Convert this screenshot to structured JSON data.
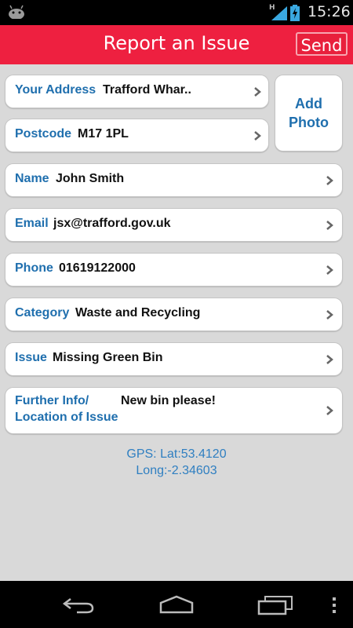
{
  "status_bar": {
    "network": "H",
    "time": "15:26"
  },
  "header": {
    "title": "Report an Issue",
    "send_label": "Send"
  },
  "photo": {
    "line1": "Add",
    "line2": "Photo"
  },
  "fields": {
    "address": {
      "label": "Your Address",
      "value": "Trafford Whar.."
    },
    "postcode": {
      "label": "Postcode",
      "value": "M17 1PL"
    },
    "name": {
      "label": "Name",
      "value": "John Smith"
    },
    "email": {
      "label": "Email",
      "value": "jsx@trafford.gov.uk"
    },
    "phone": {
      "label": "Phone",
      "value": "01619122000"
    },
    "category": {
      "label": "Category",
      "value": "Waste and Recycling"
    },
    "issue": {
      "label": "Issue",
      "value": "Missing Green Bin"
    },
    "further": {
      "label_line1": "Further Info/",
      "label_line2": "Location of Issue",
      "value": "New bin please!"
    }
  },
  "gps": {
    "lat": "GPS: Lat:53.4120",
    "long": "Long:-2.34603"
  },
  "icons": {
    "android": "android-icon",
    "signal": "signal-icon",
    "battery": "battery-charging-icon",
    "chevron": "chevron-right-icon",
    "back": "back-icon",
    "home": "home-icon",
    "recents": "recent-apps-icon",
    "menu": "overflow-menu-icon"
  },
  "colors": {
    "header": "#ee2040",
    "label": "#1f6fae",
    "gps": "#2f7fc1",
    "background": "#d9d9d9"
  }
}
